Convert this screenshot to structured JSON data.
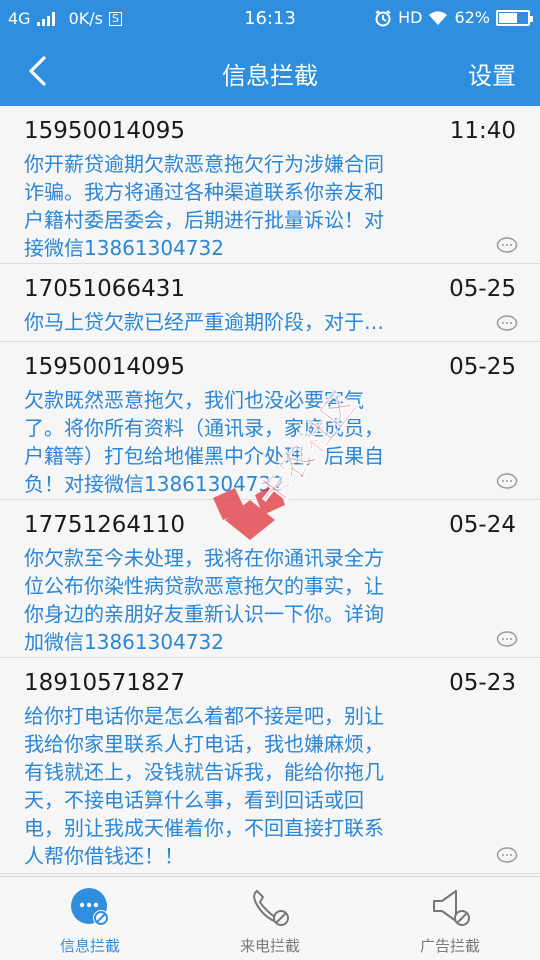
{
  "status_bar": {
    "network": "4G",
    "speed": "0K/s",
    "s_badge": "S",
    "time": "16:13",
    "hd": "HD",
    "battery": "62%"
  },
  "header": {
    "title": "信息拦截",
    "settings_label": "设置"
  },
  "messages": [
    {
      "number": "15950014095",
      "time": "11:40",
      "lines": [
        "你开薪贷逾期欠款恶意拖欠行为涉嫌合同",
        "诈骗。我方将通过各种渠道联系你亲友和",
        "户籍村委居委会，后期进行批量诉讼！对",
        "接微信13861304732"
      ]
    },
    {
      "number": "17051066431",
      "time": "05-25",
      "lines": [
        " 你马上贷欠款已经严重逾期阶段，对于…"
      ]
    },
    {
      "number": "15950014095",
      "time": "05-25",
      "lines": [
        "欠款既然恶意拖欠，我们也没必要客气",
        "了。将你所有资料（通讯录，家庭成员，",
        "户籍等）打包给地催黑中介处理，后果自",
        "负！对接微信13861304732"
      ]
    },
    {
      "number": "17751264110",
      "time": "05-24",
      "lines": [
        "你欠款至今未处理，我将在你通讯录全方",
        "位公布你染性病贷款恶意拖欠的事实，让",
        "你身边的亲朋好友重新认识一下你。详询",
        "加微信13861304732"
      ]
    },
    {
      "number": "18910571827",
      "time": "05-23",
      "lines": [
        "给你打电话你是怎么着都不接是吧，别让",
        "我给你家里联系人打电话，我也嫌麻烦，",
        "有钱就还上，没钱就告诉我，能给你拖几",
        "天，不接电话算什么事，看到回话或回",
        "电，别让我成天催着你，不回直接打联系",
        "人帮你借钱还！！"
      ]
    }
  ],
  "tabs": [
    {
      "label": "信息拦截",
      "icon": "message-block-icon",
      "active": true
    },
    {
      "label": "来电拦截",
      "icon": "phone-block-icon",
      "active": false
    },
    {
      "label": "广告拦截",
      "icon": "ad-block-icon",
      "active": false
    }
  ],
  "watermark": {
    "text": "卡农社区"
  },
  "colors": {
    "accent": "#2f8fde",
    "message_text": "#2a86d6",
    "watermark_red": "#e0343c"
  }
}
